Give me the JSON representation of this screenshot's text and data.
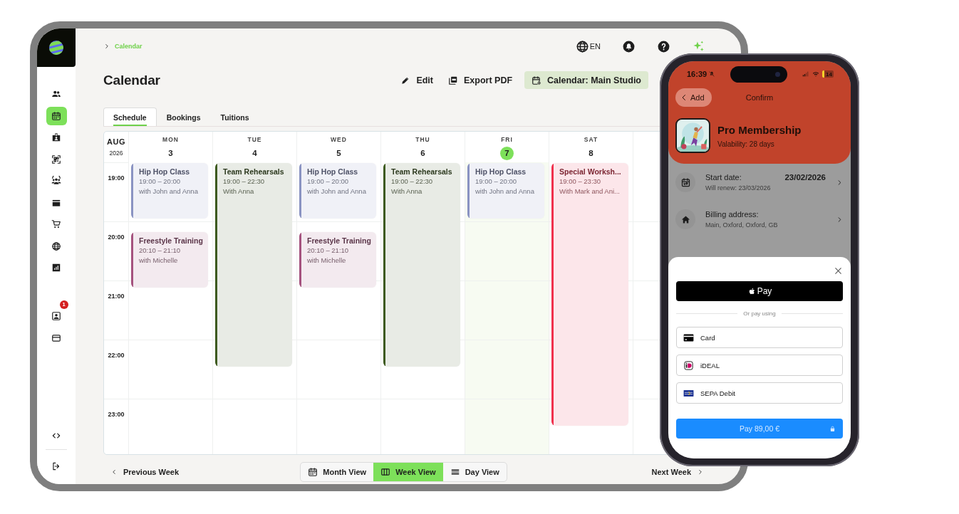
{
  "sidebar": {
    "items": [
      {
        "selected": false
      },
      {
        "selected": true
      },
      {
        "selected": false
      },
      {
        "selected": false
      },
      {
        "selected": false
      },
      {
        "selected": false
      },
      {
        "selected": false
      },
      {
        "selected": false
      },
      {
        "selected": false
      },
      {
        "selected": false,
        "badge": "1"
      },
      {
        "selected": false
      },
      {
        "selected": false
      },
      {
        "selected": false
      }
    ]
  },
  "breadcrumb": {
    "current": "Calendar"
  },
  "top_bar": {
    "language": "EN"
  },
  "title": "Calendar",
  "actions": [
    {
      "label": "Edit",
      "selected": false
    },
    {
      "label": "Export PDF",
      "selected": false
    },
    {
      "label": "Calendar: Main Studio",
      "selected": true
    }
  ],
  "tabs": [
    {
      "label": "Schedule",
      "selected": true
    },
    {
      "label": "Bookings",
      "selected": false
    },
    {
      "label": "Tuitions",
      "selected": false
    }
  ],
  "calendar": {
    "month": "AUG",
    "year": "2026",
    "hours": [
      "19:00",
      "20:00",
      "21:00",
      "22:00",
      "23:00"
    ],
    "days": [
      {
        "weekday": "MON",
        "date": "3",
        "today": false,
        "events": [
          {
            "title": "Hip Hop Class",
            "time": "19:00 – 20:00",
            "people": "with John and Anna",
            "color": "#8a93c2"
          },
          {
            "title": "Freestyle Training",
            "time": "20:10 – 21:10",
            "people": "with Michelle",
            "color": "#a5527e"
          }
        ]
      },
      {
        "weekday": "TUE",
        "date": "4",
        "today": false,
        "events": [
          {
            "title": "Team Rehearsals",
            "time": "19:00 – 22:30",
            "people": "With Anna",
            "color": "#3d5a1f"
          }
        ]
      },
      {
        "weekday": "WED",
        "date": "5",
        "today": false,
        "events": [
          {
            "title": "Hip Hop Class",
            "time": "19:00 – 20:00",
            "people": "with John and Anna",
            "color": "#8a93c2"
          },
          {
            "title": "Freestyle Training",
            "time": "20:10 – 21:10",
            "people": "with Michelle",
            "color": "#a5527e"
          }
        ]
      },
      {
        "weekday": "THU",
        "date": "6",
        "today": false,
        "events": [
          {
            "title": "Team Rehearsals",
            "time": "19:00 – 22:30",
            "people": "With Anna",
            "color": "#3d5a1f"
          }
        ]
      },
      {
        "weekday": "FRI",
        "date": "7",
        "today": true,
        "events": [
          {
            "title": "Hip Hop Class",
            "time": "19:00 – 20:00",
            "people": "with John and Anna",
            "color": "#8a93c2"
          }
        ]
      },
      {
        "weekday": "SAT",
        "date": "8",
        "today": false,
        "events": [
          {
            "title": "Special Worksh...",
            "time": "19:00 – 23:30",
            "people": "With Mark and Ani...",
            "color": "#f0304c"
          }
        ]
      }
    ]
  },
  "footer": {
    "previous": "Previous Week",
    "next": "Next Week",
    "views": [
      {
        "label": "Month View",
        "selected": false
      },
      {
        "label": "Week View",
        "selected": true
      },
      {
        "label": "Day View",
        "selected": false
      }
    ]
  },
  "phone": {
    "status_bar": {
      "time": "16:39",
      "battery": "14"
    },
    "nav": {
      "back": "Add",
      "title": "Confirm"
    },
    "product": {
      "name": "Pro Membership",
      "validity": "Valability: 28 days"
    },
    "details": [
      {
        "label": "Start date:",
        "sub": "Will renew: 23/03/2026",
        "value": "23/02/2026"
      },
      {
        "label": "Billing address:",
        "sub": "Main, Oxford, Oxford, GB"
      }
    ],
    "sheet": {
      "wallet_button": "Pay",
      "divider": "Or pay using",
      "methods": [
        {
          "label": "Card"
        },
        {
          "label": "iDEAL"
        },
        {
          "label": "SEPA Debit"
        }
      ],
      "pay_button": "Pay 89,00 €"
    }
  }
}
